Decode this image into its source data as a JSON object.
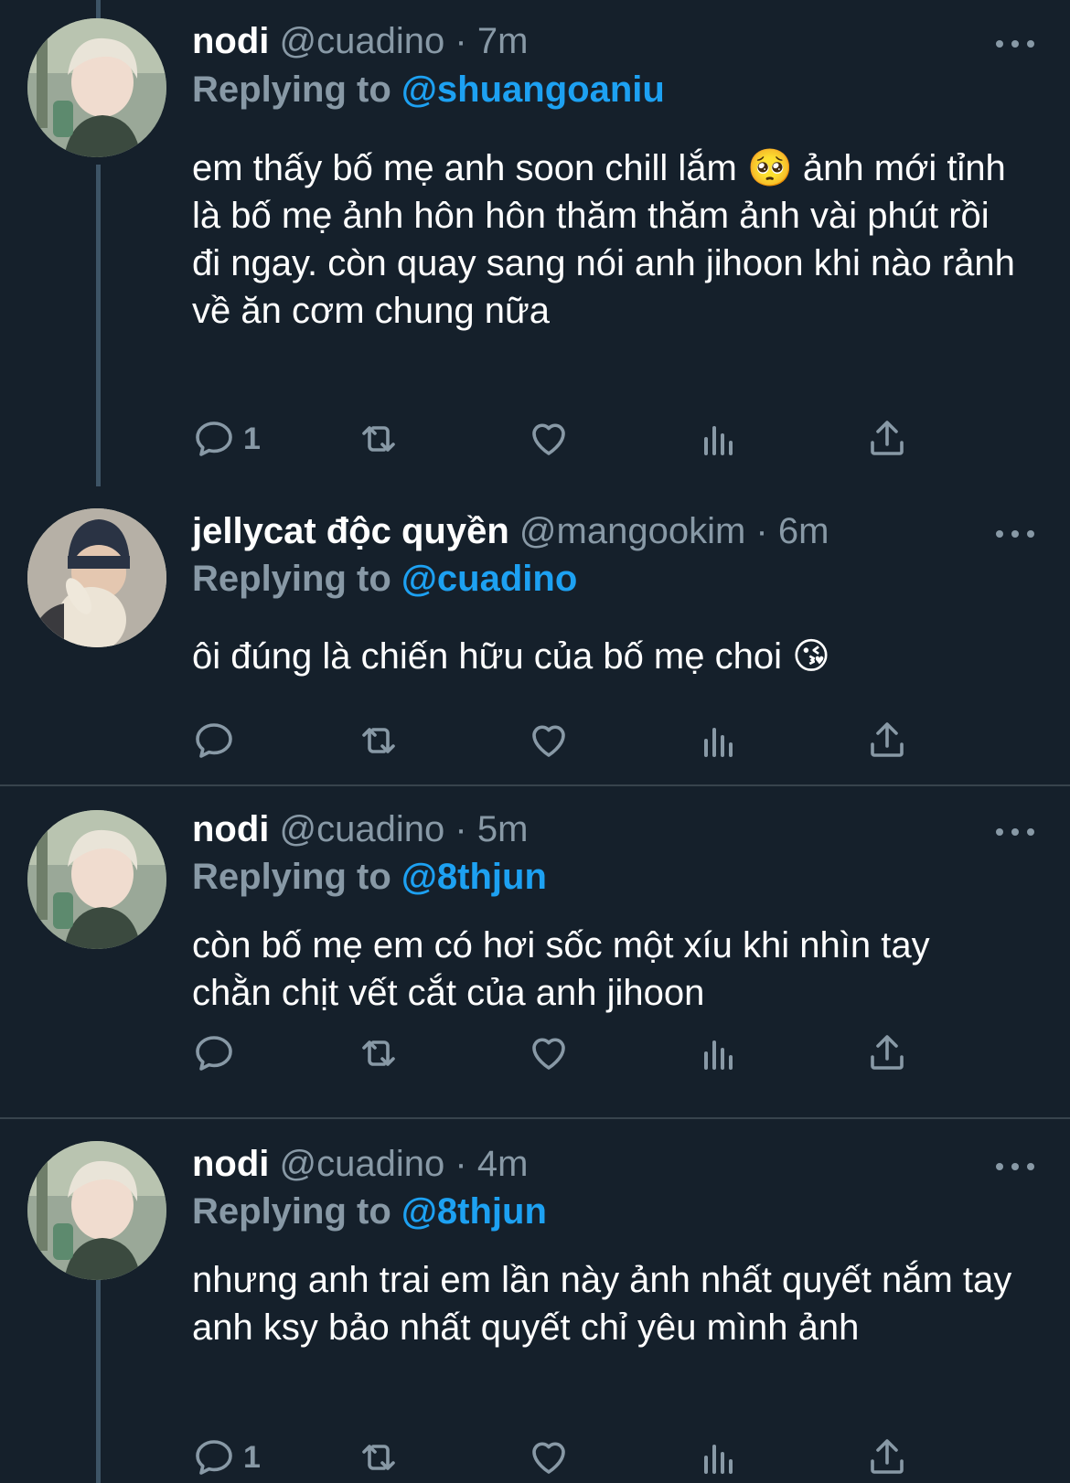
{
  "tweets": [
    {
      "name": "nodi",
      "handle": "@cuadino",
      "sep": "·",
      "time": "7m",
      "replying_label": "Replying to",
      "replying_to": "@shuangoaniu",
      "text_before_emoji": "em thấy bố mẹ anh soon chill lắm ",
      "emoji": "🥺",
      "text_after_emoji": "  ảnh mới tỉnh là bố mẹ ảnh hôn hôn thăm thăm ảnh vài phút rồi đi ngay. còn quay sang nói anh jihoon khi nào rảnh về ăn cơm chung nữa",
      "reply_count": "1"
    },
    {
      "name": "jellycat độc quyền",
      "handle": "@mangookim",
      "sep": "·",
      "time": "6m",
      "replying_label": "Replying to",
      "replying_to": "@cuadino",
      "text_before_emoji": "ôi đúng là chiến hữu của bố mẹ choi ",
      "emoji": "😘",
      "text_after_emoji": "",
      "reply_count": ""
    },
    {
      "name": "nodi",
      "handle": "@cuadino",
      "sep": "·",
      "time": "5m",
      "replying_label": "Replying to",
      "replying_to": "@8thjun",
      "text_before_emoji": "còn bố mẹ em có hơi sốc một xíu khi nhìn tay chằn chịt vết cắt của anh jihoon",
      "emoji": "",
      "text_after_emoji": "",
      "reply_count": ""
    },
    {
      "name": "nodi",
      "handle": "@cuadino",
      "sep": "·",
      "time": "4m",
      "replying_label": "Replying to",
      "replying_to": "@8thjun",
      "text_before_emoji": "nhưng anh trai em lần này ảnh nhất quyết nắm tay anh ksy bảo nhất quyết chỉ yêu mình ảnh",
      "emoji": "",
      "text_after_emoji": "",
      "reply_count": "1"
    }
  ],
  "icons": {
    "reply": "reply-icon",
    "retweet": "retweet-icon",
    "like": "heart-icon",
    "analytics": "analytics-icon",
    "share": "share-icon",
    "more": "more-icon"
  },
  "colors": {
    "background": "#15202b",
    "secondary_text": "#8899a6",
    "mention": "#1da1f2",
    "divider": "#38444d",
    "thread_line": "#3d5466"
  }
}
